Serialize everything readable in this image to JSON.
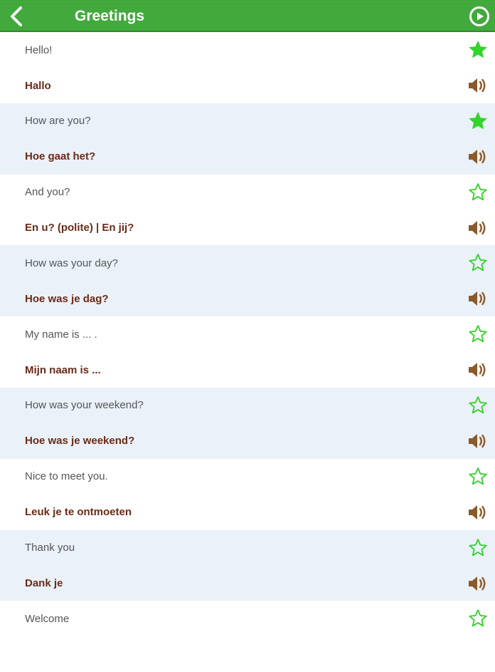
{
  "header": {
    "title": "Greetings"
  },
  "colors": {
    "header_green": "#44ab3f",
    "star_green": "#33d42a",
    "speaker_brown": "#8a5a2b",
    "translation_brown": "#6b2a16",
    "alt_row": "#eaf1f9"
  },
  "phrases": [
    {
      "english": "Hello!",
      "dutch": "Hallo",
      "favorite": true
    },
    {
      "english": "How are you?",
      "dutch": "Hoe gaat het?",
      "favorite": true
    },
    {
      "english": "And you?",
      "dutch": "En u? (polite) | En jij?",
      "favorite": false
    },
    {
      "english": "How was your day?",
      "dutch": "Hoe was je dag?",
      "favorite": false
    },
    {
      "english": "My name is ... .",
      "dutch": "Mijn naam is ...",
      "favorite": false
    },
    {
      "english": "How was your weekend?",
      "dutch": "Hoe was je weekend?",
      "favorite": false
    },
    {
      "english": "Nice to meet you.",
      "dutch": "Leuk je te ontmoeten",
      "favorite": false
    },
    {
      "english": "Thank you",
      "dutch": "Dank je",
      "favorite": false
    },
    {
      "english": "Welcome",
      "dutch": "",
      "favorite": false
    }
  ]
}
